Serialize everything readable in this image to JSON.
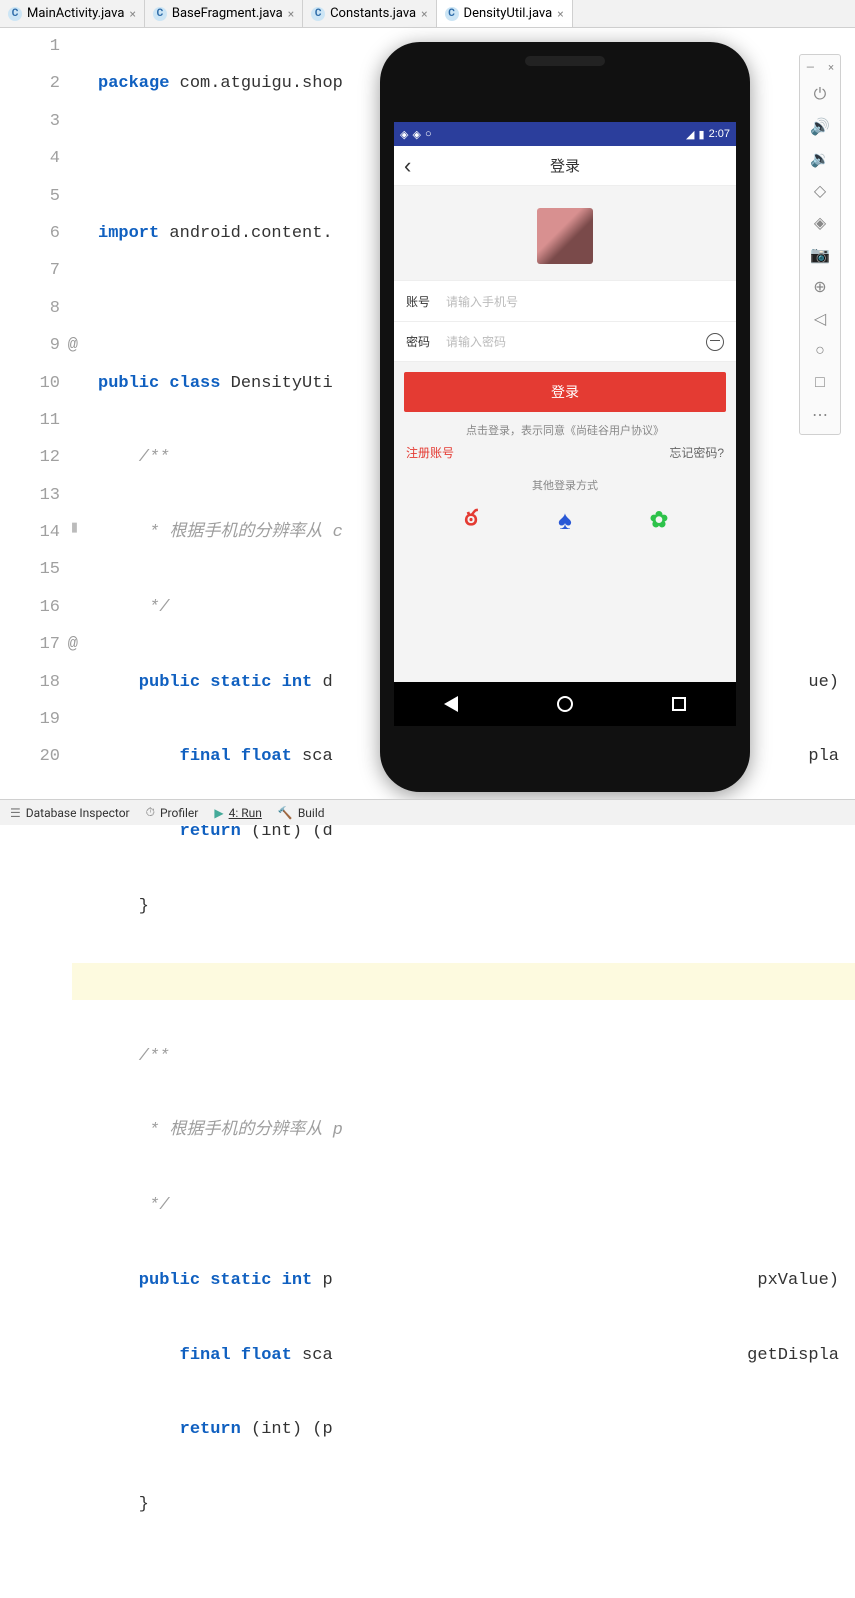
{
  "tabs": [
    {
      "label": "MainActivity.java",
      "active": false
    },
    {
      "label": "BaseFragment.java",
      "active": false
    },
    {
      "label": "Constants.java",
      "active": false
    },
    {
      "label": "DensityUtil.java",
      "active": true
    }
  ],
  "gutter": {
    "1": "1",
    "2": "2",
    "3": "3",
    "4": "4",
    "5": "5",
    "6": "6",
    "7": "7",
    "8": "8",
    "9": "9",
    "10": "10",
    "11": "11",
    "12": "12",
    "13": "13",
    "14": "14",
    "15": "15",
    "16": "16",
    "17": "17",
    "18": "18",
    "19": "19",
    "20": "20"
  },
  "code": {
    "l1a": "package",
    "l1b": " com.atguigu.shop",
    "l3a": "import",
    "l3b": " android.content.",
    "l5a": "public class",
    "l5b": " DensityUti",
    "l6": "    /**",
    "l7": "     * 根据手机的分辨率从 c",
    "l8": "     */",
    "l9a": "    public static int",
    "l9b": " d",
    "l9c": "ue)",
    "l10a": "        final float",
    "l10b": " sca",
    "l10c": "pla",
    "l11a": "        return ",
    "l11b": "(int)",
    "l11c": " (d",
    "l12": "    }",
    "l14": "    /**",
    "l15": "     * 根据手机的分辨率从 p",
    "l16": "     */",
    "l17a": "    public static int",
    "l17b": " p",
    "l17c": "pxValue)",
    "l18a": "        final float",
    "l18b": " sca",
    "l18c": "getDispla",
    "l19a": "        return ",
    "l19b": "(int)",
    "l19c": " (p",
    "l20": "    }"
  },
  "statusbar": {
    "time": "2:07"
  },
  "app": {
    "title": "登录",
    "account_label": "账号",
    "account_placeholder": "请输入手机号",
    "password_label": "密码",
    "password_placeholder": "请输入密码",
    "login_btn": "登录",
    "consent": "点击登录，表示同意《尚硅谷用户协议》",
    "register": "注册账号",
    "forgot": "忘记密码?",
    "other": "其他登录方式"
  },
  "bottombar": {
    "db": "Database Inspector",
    "profiler": "Profiler",
    "run": "4: Run",
    "build": "Build"
  }
}
